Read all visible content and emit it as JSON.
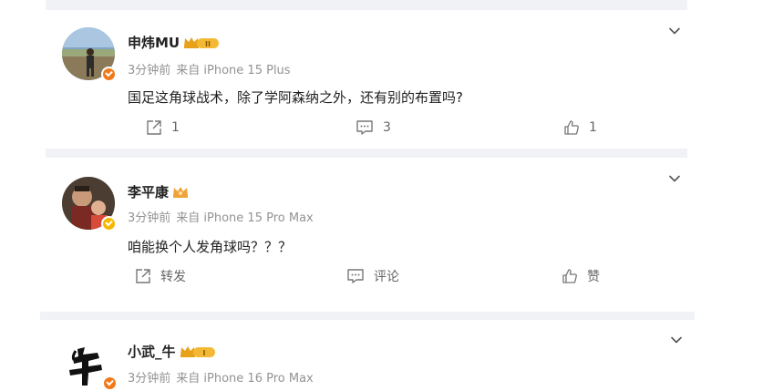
{
  "posts": [
    {
      "username": "申炜MU",
      "time": "3分钟前",
      "source": "来自 iPhone 15 Plus",
      "content": "国足这角球战术，除了学阿森纳之外，还有别的布置吗?",
      "repost_label": "1",
      "comment_label": "3",
      "like_label": "1",
      "badge_level": "II",
      "verified_color": "#f07a1a"
    },
    {
      "username": "李平康",
      "time": "3分钟前",
      "source": "来自 iPhone 15 Pro Max",
      "content": "咱能换个人发角球吗？？？",
      "repost_label": "转发",
      "comment_label": "评论",
      "like_label": "赞",
      "verified_color": "#f5b800"
    },
    {
      "username": "小武_牛",
      "time": "3分钟前",
      "source": "来自 iPhone 16 Pro Max",
      "badge_level": "I",
      "verified_color": "#f07a1a"
    }
  ],
  "colors": {
    "separator": "#f1f2f5",
    "meta_text": "#939393",
    "action_text": "#666666",
    "badge_gold": "#f5b800",
    "badge_orange": "#f07a1a"
  },
  "icons": {
    "repost": "repost-icon",
    "comment": "comment-icon",
    "like": "like-icon",
    "menu": "chevron-down-icon",
    "verified": "verified-check-icon",
    "vip": "crown-badge-icon"
  }
}
